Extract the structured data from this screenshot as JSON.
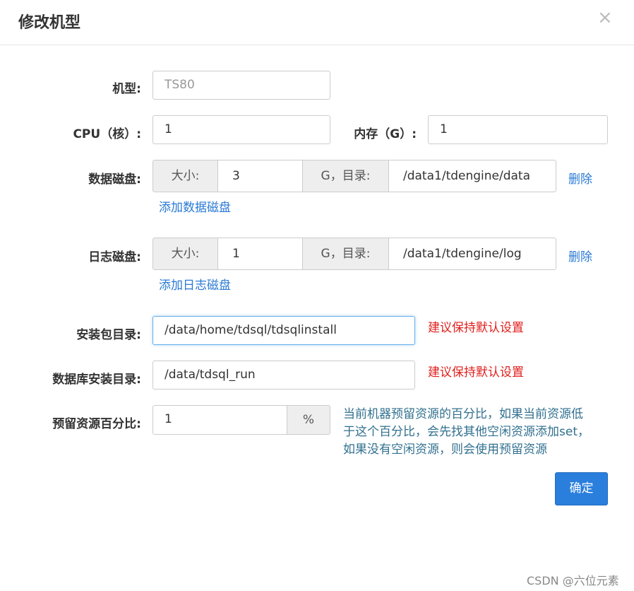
{
  "dialog": {
    "title": "修改机型",
    "close_icon": "×",
    "ok_label": "确定"
  },
  "form": {
    "model": {
      "label": "机型:",
      "placeholder": "TS80"
    },
    "cpu": {
      "label": "CPU（核）:",
      "value": "1"
    },
    "memory": {
      "label": "内存（G）:",
      "value": "1"
    },
    "data_disk": {
      "label": "数据磁盘:",
      "size_label": "大小:",
      "size": "3",
      "dir_label": "G，目录:",
      "dir": "/data1/tdengine/data",
      "delete_label": "删除",
      "add_label": "添加数据磁盘"
    },
    "log_disk": {
      "label": "日志磁盘:",
      "size_label": "大小:",
      "size": "1",
      "dir_label": "G，目录:",
      "dir": "/data1/tdengine/log",
      "delete_label": "删除",
      "add_label": "添加日志磁盘"
    },
    "install_pkg_dir": {
      "label": "安装包目录:",
      "value": "/data/home/tdsql/tdsqlinstall",
      "hint": "建议保持默认设置"
    },
    "db_install_dir": {
      "label": "数据库安装目录:",
      "value": "/data/tdsql_run",
      "hint": "建议保持默认设置"
    },
    "reserve_percent": {
      "label": "预留资源百分比:",
      "value": "1",
      "unit": "%",
      "help_lines": [
        "当前机器预留资源的百分比，如果当前资源低",
        "于这个百分比，会先找其他空闲资源添加set，",
        "如果没有空闲资源，则会使用预留资源"
      ]
    }
  },
  "watermark": "CSDN @六位元素",
  "colors": {
    "primary": "#2a7fdd",
    "link": "#2a7ad4",
    "warning": "#e0201d",
    "help": "#31708f"
  }
}
